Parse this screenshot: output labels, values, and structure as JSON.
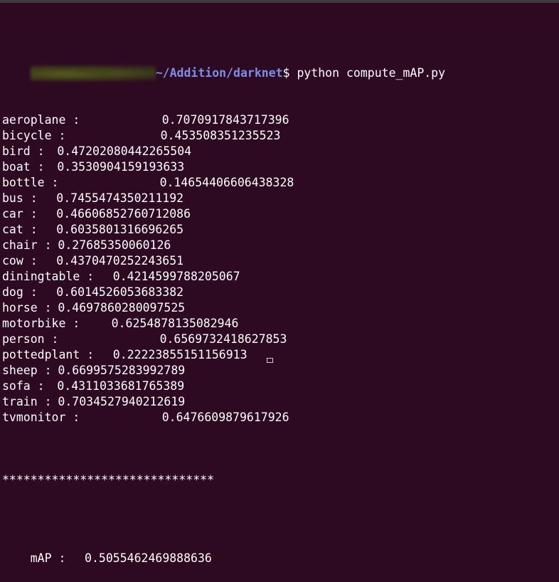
{
  "window": {
    "kind": "terminal-emulator",
    "background_color": "#2d0a22",
    "foreground_color": "#ffffff",
    "chrome_strip_color": "#3c3b37",
    "path_color": "#7b8fe8"
  },
  "prompt": {
    "user_host": "",
    "user_host_redacted": true,
    "path": "~/Addition/darknet",
    "symbol": "$",
    "command": "python compute_mAP.py"
  },
  "results": {
    "separator": "******************************",
    "rows": [
      {
        "label": "aeroplane :",
        "pad": "\t\t",
        "value": "0.7070917843717396"
      },
      {
        "label": "bicycle :",
        "pad": "\t\t",
        "value": "0.453508351235523"
      },
      {
        "label": "bird :",
        "pad": "\t",
        "value": "0.47202080442265504"
      },
      {
        "label": "boat :",
        "pad": "\t",
        "value": "0.3530904159193633"
      },
      {
        "label": "bottle :",
        "pad": "\t\t",
        "value": "0.14654406606438328"
      },
      {
        "label": "bus :",
        "pad": "\t",
        "value": "0.7455474350211192"
      },
      {
        "label": "car :",
        "pad": "\t",
        "value": "0.46606852760712086"
      },
      {
        "label": "cat :",
        "pad": "\t",
        "value": "0.6035801316696265"
      },
      {
        "label": "chair :",
        "pad": "\t",
        "value": "0.27685350060126"
      },
      {
        "label": "cow :",
        "pad": "\t",
        "value": "0.4370470252243651"
      },
      {
        "label": "diningtable :",
        "pad": "\t",
        "value": "0.4214599788205067"
      },
      {
        "label": "dog :",
        "pad": "\t",
        "value": "0.6014526053683382"
      },
      {
        "label": "horse :",
        "pad": "\t",
        "value": "0.4697860280097525"
      },
      {
        "label": "motorbike :",
        "pad": "\t",
        "value": "0.6254878135082946"
      },
      {
        "label": "person :",
        "pad": "\t\t",
        "value": "0.6569732418627853"
      },
      {
        "label": "pottedplant :",
        "pad": "\t",
        "value": "0.22223855151156913"
      },
      {
        "label": "sheep :",
        "pad": "\t",
        "value": "0.6699575283992789"
      },
      {
        "label": "sofa :",
        "pad": "\t",
        "value": "0.4311033681765389"
      },
      {
        "label": "train :",
        "pad": "\t",
        "value": "0.7034527940212619"
      },
      {
        "label": "tvmonitor :",
        "pad": "\t\t",
        "value": "0.6476609879617926"
      }
    ],
    "summary": {
      "label": "mAP :",
      "pad": "\t",
      "value": "0.5055462469888636"
    }
  },
  "cursor": {
    "shape": "hollow-block",
    "visible": true
  }
}
